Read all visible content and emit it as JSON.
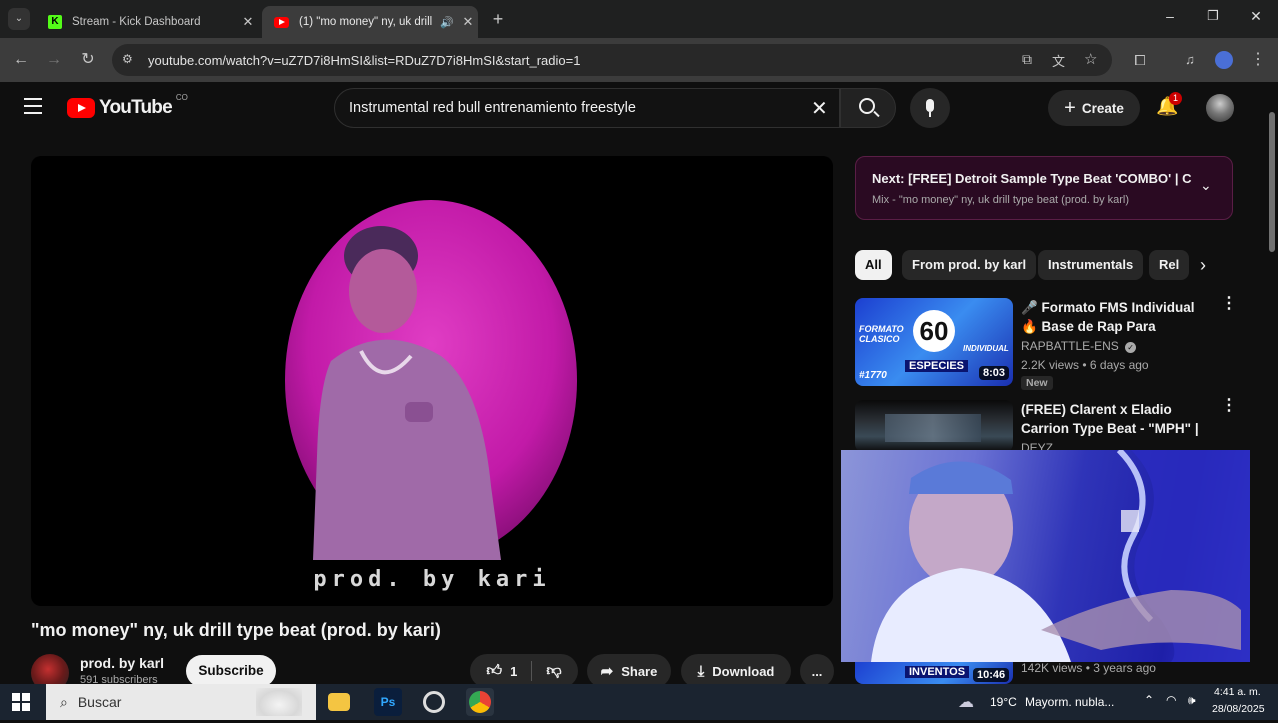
{
  "browser": {
    "tabs": [
      {
        "title": "Stream - Kick Dashboard",
        "favicon": "kick-icon",
        "color": "#53fc18"
      },
      {
        "title": "(1) \"mo money\" ny, uk drill",
        "favicon": "youtube-icon",
        "color": "#ff0000"
      }
    ],
    "url": "youtube.com/watch?v=uZ7D7i8HmSI&list=RDuZ7D7i8HmSI&start_radio=1"
  },
  "youtube": {
    "logo_text": "YouTube",
    "country_code": "CO",
    "search_query": "Instrumental red bull entrenamiento freestyle",
    "create_label": "Create",
    "notification_count": "1"
  },
  "video": {
    "thumbnail_caption": "prod. by kari",
    "title": "\"mo money\" ny, uk drill type beat (prod. by kari)",
    "channel": "prod. by karl",
    "subscribers": "591 subscribers",
    "subscribe_label": "Subscribe",
    "likes": "1",
    "share_label": "Share",
    "download_label": "Download",
    "more_label": "..."
  },
  "sidebar": {
    "next_label": "Next: [FREE] Detroit Sample Type Beat 'COMBO' | Cl...",
    "next_sub": "Mix - \"mo money\" ny, uk drill type beat (prod. by karl)",
    "chips": [
      "All",
      "From prod. by karl",
      "Instrumentals",
      "Rel"
    ],
    "recommendations": [
      {
        "title": "🎤 Formato FMS Individual 🔥 Base de Rap Para Improvisar ...",
        "channel": "RAPBATTLE-ENS",
        "meta": "2.2K views • 6 days ago",
        "badge": "New",
        "duration": "8:03",
        "thumb_text_1": "FORMATO CLASICO",
        "thumb_number": "60",
        "thumb_text_2": "INDIVIDUAL",
        "thumb_text_3": "ESPECIES",
        "thumb_tag": "#1770"
      },
      {
        "title": "(FREE) Clarent x Eladio Carrion Type Beat - \"MPH\" | Detroit Ty...",
        "channel": "DEYZ"
      },
      {
        "meta": "142K views • 3 years ago",
        "duration": "10:46",
        "thumb_text": "INVENTOS"
      }
    ]
  },
  "taskbar": {
    "search_placeholder": "Buscar",
    "weather_temp": "19°C",
    "weather_desc": "Mayorm. nubla...",
    "time": "4:41 a. m.",
    "date": "28/08/2025"
  },
  "colors": {
    "youtube_red": "#ff0000",
    "thumbnail_magenta": "#c21aa8",
    "kick_green": "#53fc18"
  }
}
